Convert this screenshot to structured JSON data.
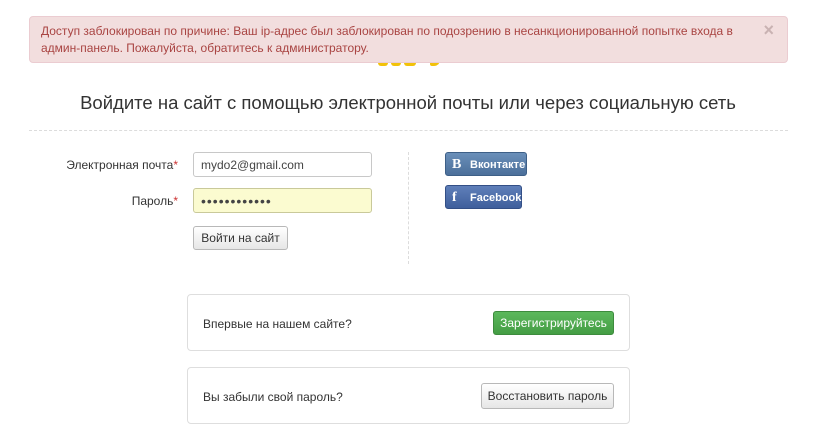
{
  "alert": {
    "message": "Доступ заблокирован по причине: Ваш ip-адрес был заблокирован по подозрению в несанкционированной попытке входа в админ-панель. Пожалуйста, обратитесь к администратору.",
    "close_glyph": "×"
  },
  "heading": "Войдите на сайт с помощью электронной почты или через социальную сеть",
  "form": {
    "email_label": "Электронная почта",
    "password_label": "Пароль",
    "required_mark": "*",
    "email_value": "mydo2@gmail.com",
    "password_value": "••••••••••••",
    "submit_label": "Войти на сайт"
  },
  "social": {
    "vk": {
      "icon": "vk-icon",
      "glyph": "B",
      "label": "Вконтакте",
      "color": "#4b6f9a"
    },
    "facebook": {
      "icon": "facebook-icon",
      "glyph": "f",
      "label": "Facebook",
      "color": "#3f5f9c"
    }
  },
  "register_panel": {
    "text": "Впервые на нашем сайте?",
    "button_label": "Зарегистрируйтесь",
    "button_color": "#5cb85c"
  },
  "restore_panel": {
    "text": "Вы забыли свой пароль?",
    "button_label": "Восстановить пароль"
  },
  "colors": {
    "alert_bg": "#f2dede",
    "alert_text": "#a94442",
    "logo_accent": "#f2c20a"
  }
}
